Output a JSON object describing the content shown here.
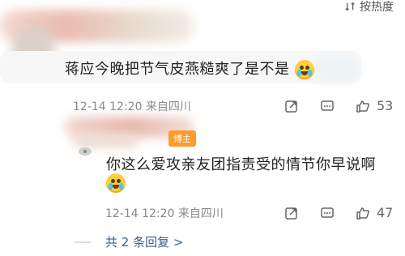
{
  "sort": {
    "label": "按热度",
    "icon": "sort-icon"
  },
  "comment1": {
    "text": "蒋应今晚把节气皮燕糙爽了是不是",
    "emoji": "cry-laugh",
    "time": "12-14 12:20",
    "location": "来自四川",
    "likes": "53"
  },
  "comment2": {
    "badge": "博主",
    "text": "你这么爱攻亲友团指责受的情节你早说啊",
    "emoji": "cry-laugh",
    "time": "12-14 12:20",
    "location": "来自四川",
    "likes": "47"
  },
  "replies": {
    "label": "共 2 条回复 >"
  },
  "icons": [
    "share-icon",
    "comment-icon",
    "like-icon",
    "badge-icon"
  ]
}
